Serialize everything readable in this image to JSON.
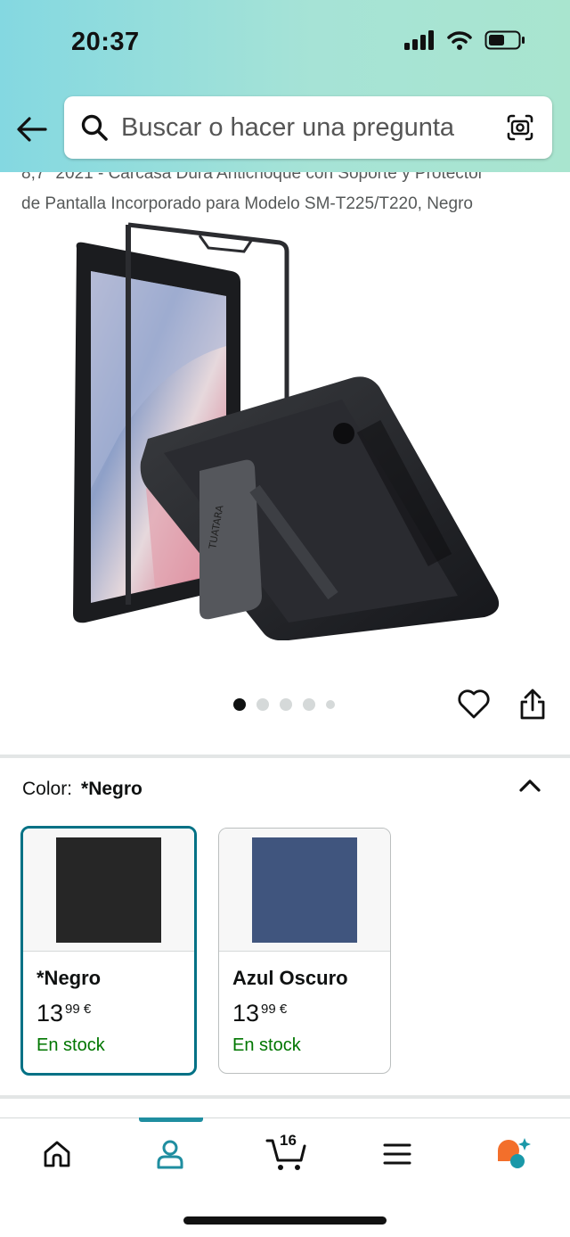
{
  "status_bar": {
    "time": "20:37"
  },
  "search": {
    "placeholder": "Buscar o hacer una pregunta"
  },
  "product": {
    "title_line1": "8,7\" 2021 - Carcasa Dura Antichoque con Soporte y Protector",
    "title_line2": "de Pantalla Incorporado para Modelo SM-T225/T220, Negro",
    "image_brand": "TUATARA",
    "image_count": 5,
    "current_image_index": 1
  },
  "color_section": {
    "label": "Color:",
    "selected_value": "*Negro",
    "options": [
      {
        "name": "*Negro",
        "price_whole": "13",
        "price_fraction": "99",
        "currency": "€",
        "stock": "En stock",
        "swatch_color": "#262626",
        "selected": true
      },
      {
        "name": "Azul Oscuro",
        "price_whole": "13",
        "price_fraction": "99",
        "currency": "€",
        "stock": "En stock",
        "swatch_color": "#40557e",
        "selected": false
      }
    ]
  },
  "bottom_nav": {
    "items": [
      "home-icon",
      "account-icon",
      "cart-icon",
      "menu-icon",
      "rufus-icon"
    ],
    "active_item": "account-icon",
    "cart_count": "16"
  },
  "colors": {
    "accent": "#007185",
    "in_stock": "#007600",
    "nav_active": "#1f8ea0",
    "rufus_orange": "#f36f2b",
    "rufus_teal": "#1a98a8"
  }
}
